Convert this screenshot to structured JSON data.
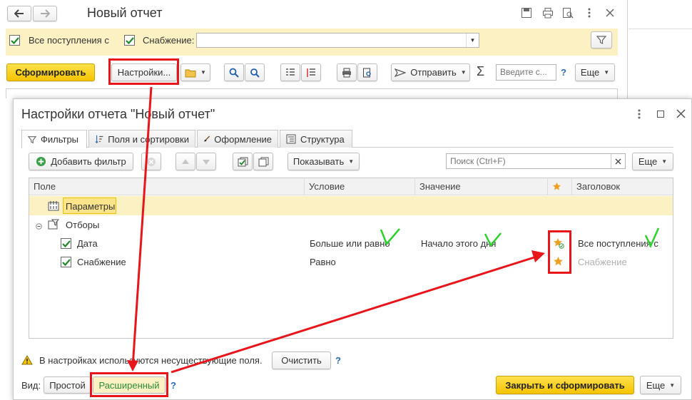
{
  "main_window": {
    "title": "Новый отчет",
    "filter_all_receipts_label": "Все поступления с",
    "filter_supply_label": "Снабжение:",
    "supply_value": "",
    "generate_button": "Сформировать",
    "settings_button": "Настройки...",
    "send_button": "Отправить",
    "search_placeholder": "Введите с...",
    "help": "?",
    "more_button": "Еще"
  },
  "dialog": {
    "title": "Настройки отчета \"Новый отчет\"",
    "tabs": [
      "Фильтры",
      "Поля и сортировки",
      "Оформление",
      "Структура"
    ],
    "add_filter_button": "Добавить фильтр",
    "show_button": "Показывать",
    "search_placeholder": "Поиск (Ctrl+F)",
    "more_button": "Еще",
    "columns": [
      "Поле",
      "Условие",
      "Значение",
      "Заголовок"
    ],
    "rows": [
      {
        "field": "Параметры"
      },
      {
        "field": "Отборы"
      },
      {
        "field": "Дата",
        "condition": "Больше или равно",
        "value": "Начало этого дня",
        "caption": "Все поступления с"
      },
      {
        "field": "Снабжение",
        "condition": "Равно",
        "value": "",
        "caption": "Снабжение"
      }
    ],
    "warning_text": "В настройках используются несуществующие поля.",
    "clear_button": "Очистить",
    "view_label": "Вид:",
    "simple_button": "Простой",
    "extended_button": "Расширенный",
    "help": "?",
    "close_generate_button": "Закрыть и сформировать",
    "more_bottom_button": "Еще"
  },
  "colors": {
    "accent_yellow": "#f5c400",
    "highlight_bg": "#fbf1c3",
    "annotation_red": "#e8151b",
    "annotation_green": "#2ad12a"
  }
}
